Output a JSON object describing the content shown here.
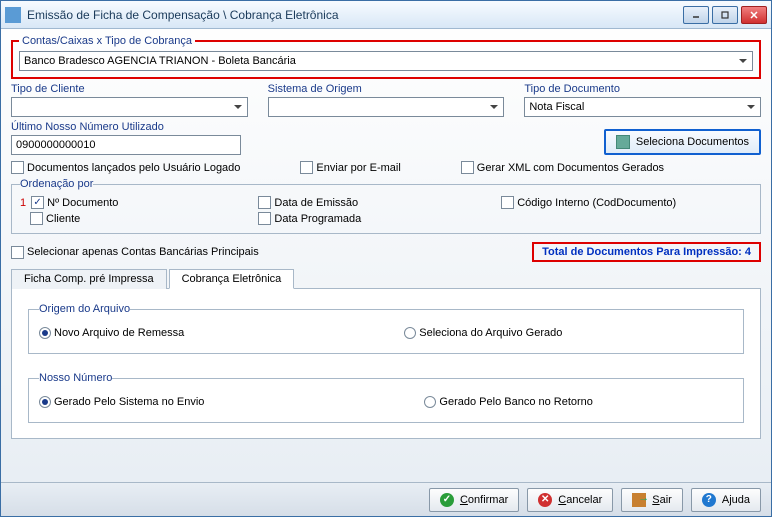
{
  "window": {
    "title": "Emissão de Ficha de Compensação \\ Cobrança Eletrônica"
  },
  "account": {
    "legend": "Contas/Caixas x Tipo de Cobrança",
    "value": "Banco Bradesco AGENCIA TRIANON - Boleta Bancária"
  },
  "filters": {
    "tipoCliente": {
      "label": "Tipo de Cliente",
      "value": ""
    },
    "sistemaOrigem": {
      "label": "Sistema de Origem",
      "value": ""
    },
    "tipoDocumento": {
      "label": "Tipo de Documento",
      "value": "Nota Fiscal"
    }
  },
  "ultimoNosso": {
    "label": "Último Nosso Número Utilizado",
    "value": "0900000000010"
  },
  "actions": {
    "selecionaDoc": "Seleciona Documentos"
  },
  "checks": {
    "docUsuario": "Documentos lançados pelo Usuário Logado",
    "enviarEmail": "Enviar por E-mail",
    "gerarXml": "Gerar XML com Documentos Gerados",
    "selContasPrincipais": "Selecionar apenas Contas Bancárias Principais"
  },
  "ordenacao": {
    "legend": "Ordenação por",
    "num": "1",
    "nDocumento": "Nº Documento",
    "cliente": "Cliente",
    "dataEmissao": "Data de Emissão",
    "dataProgramada": "Data Programada",
    "codigoInterno": "Código Interno (CodDocumento)"
  },
  "total": "Total de Documentos Para Impressão: 4",
  "tabs": {
    "ficha": "Ficha Comp. pré Impressa",
    "cobranca": "Cobrança Eletrônica"
  },
  "origemArquivo": {
    "legend": "Origem do Arquivo",
    "novo": "Novo Arquivo de Remessa",
    "seleciona": "Seleciona do Arquivo Gerado"
  },
  "nossoNumero": {
    "legend": "Nosso Número",
    "sistema": "Gerado Pelo Sistema no Envio",
    "banco": "Gerado Pelo Banco  no Retorno"
  },
  "footer": {
    "confirmar": "Confirmar",
    "cancelar": "Cancelar",
    "sair": "Sair",
    "ajuda": "Ajuda"
  }
}
